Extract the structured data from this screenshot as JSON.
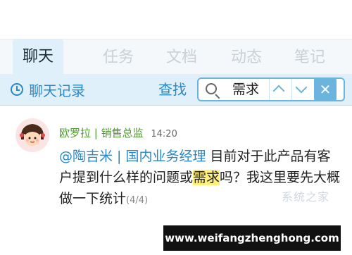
{
  "tabs": {
    "items": [
      {
        "label": "聊天"
      },
      {
        "label": "任务"
      },
      {
        "label": "文档"
      },
      {
        "label": "动态"
      },
      {
        "label": "笔记"
      }
    ]
  },
  "toolbar": {
    "history_label": "聊天记录",
    "find_label": "查找",
    "search_query": "需求",
    "close_glyph": "✕"
  },
  "message": {
    "sender": "欧罗拉 | 销售总监",
    "time": "14:20",
    "mention": "@陶吉米 | 国内业务经理",
    "text_before": " 目前对于此产品有客户提到什么样的问题或",
    "highlight": "需求",
    "text_after": "吗？我这里要先大概做一下统计",
    "counter": "(4/4)"
  },
  "watermark": "系统之家",
  "banner": "www.weifangzhenghong.com",
  "colors": {
    "accent": "#2b88c6",
    "sender": "#4e9a2e",
    "highlight": "#fff07a"
  }
}
